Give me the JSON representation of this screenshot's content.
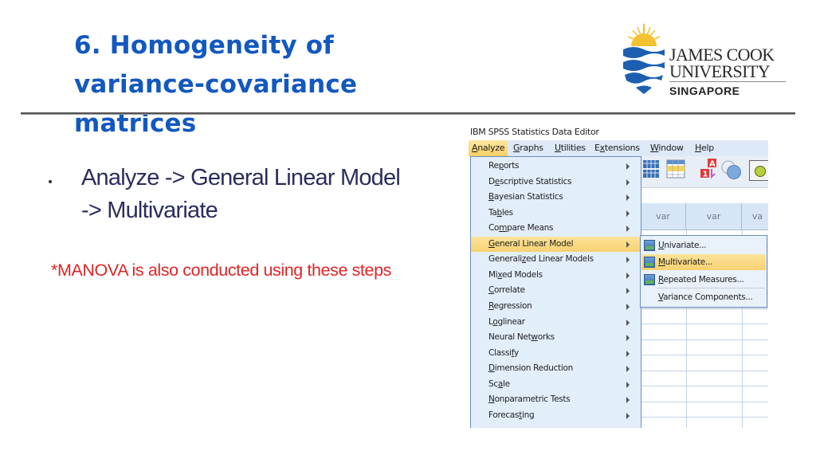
{
  "slide": {
    "title_lines": [
      "6. Homogeneity of",
      "variance-covariance",
      "matrices"
    ],
    "bullet": {
      "line1": "Analyze -> General Linear Model",
      "line2": "-> Multivariate"
    },
    "note": "*MANOVA is also conducted using these steps"
  },
  "logo": {
    "line1": "JAMES COOK",
    "line2": "UNIVERSITY",
    "line3": "SINGAPORE",
    "colors": {
      "blue": "#1c5fb0",
      "sun": "#f2c230"
    }
  },
  "spss": {
    "window_title": "IBM SPSS Statistics Data Editor",
    "menubar": [
      {
        "pre": "",
        "u": "A",
        "post": "nalyze",
        "active": true
      },
      {
        "pre": "",
        "u": "G",
        "post": "raphs"
      },
      {
        "pre": "",
        "u": "U",
        "post": "tilities"
      },
      {
        "pre": "E",
        "u": "x",
        "post": "tensions"
      },
      {
        "pre": "",
        "u": "W",
        "post": "indow"
      },
      {
        "pre": "",
        "u": "H",
        "post": "elp"
      }
    ],
    "analyze_menu": [
      {
        "pre": "Re",
        "u": "p",
        "post": "orts"
      },
      {
        "pre": "D",
        "u": "e",
        "post": "scriptive Statistics"
      },
      {
        "pre": "",
        "u": "B",
        "post": "ayesian Statistics"
      },
      {
        "pre": "Ta",
        "u": "b",
        "post": "les"
      },
      {
        "pre": "Co",
        "u": "m",
        "post": "pare Means"
      },
      {
        "pre": "",
        "u": "G",
        "post": "eneral Linear Model",
        "active": true
      },
      {
        "pre": "Generali",
        "u": "z",
        "post": "ed Linear Models"
      },
      {
        "pre": "Mi",
        "u": "x",
        "post": "ed Models"
      },
      {
        "pre": "",
        "u": "C",
        "post": "orrelate"
      },
      {
        "pre": "",
        "u": "R",
        "post": "egression"
      },
      {
        "pre": "L",
        "u": "o",
        "post": "glinear"
      },
      {
        "pre": "Neural Net",
        "u": "w",
        "post": "orks"
      },
      {
        "pre": "Classi",
        "u": "f",
        "post": "y"
      },
      {
        "pre": "",
        "u": "D",
        "post": "imension Reduction"
      },
      {
        "pre": "Sc",
        "u": "a",
        "post": "le"
      },
      {
        "pre": "",
        "u": "N",
        "post": "onparametric Tests"
      },
      {
        "pre": "Forecas",
        "u": "t",
        "post": "ing"
      }
    ],
    "glm_submenu": [
      {
        "pre": "",
        "u": "U",
        "post": "nivariate...",
        "icon": "univariate-icon"
      },
      {
        "pre": "",
        "u": "M",
        "post": "ultivariate...",
        "icon": "multivariate-icon",
        "active": true
      },
      {
        "pre": "",
        "u": "R",
        "post": "epeated Measures...",
        "icon": "repeated-measures-icon"
      },
      {
        "pre": "",
        "u": "V",
        "post": "ariance Components...",
        "icon": null
      }
    ],
    "column_headers": [
      "var",
      "var",
      "va"
    ]
  }
}
